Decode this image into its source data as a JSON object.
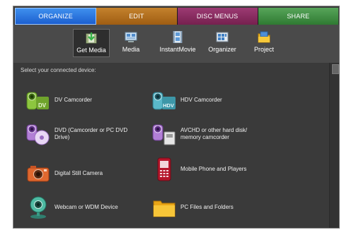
{
  "tabs": [
    {
      "label": "ORGANIZE",
      "active": true
    },
    {
      "label": "EDIT"
    },
    {
      "label": "DISC MENUS"
    },
    {
      "label": "SHARE"
    }
  ],
  "toolbar": {
    "items": [
      {
        "label": "Get Media",
        "icon": "get-media-icon",
        "selected": true
      },
      {
        "label": "Media",
        "icon": "media-icon"
      },
      {
        "label": "InstantMovie",
        "icon": "filmstrip-icon"
      },
      {
        "label": "Organizer",
        "icon": "organizer-icon"
      },
      {
        "label": "Project",
        "icon": "project-folder-icon"
      }
    ]
  },
  "prompt": "Select your connected device:",
  "devices": [
    {
      "label": "DV Camcorder",
      "icon": "dv-camcorder-icon"
    },
    {
      "label": "HDV Camcorder",
      "icon": "hdv-camcorder-icon"
    },
    {
      "label": "DVD (Camcorder or PC DVD Drive)",
      "icon": "dvd-camcorder-icon"
    },
    {
      "label": "AVCHD or other hard disk/ memory camcorder",
      "icon": "avchd-camcorder-icon"
    },
    {
      "label": "Digital Still Camera",
      "icon": "digital-camera-icon"
    },
    {
      "label": "Mobile Phone and Players",
      "icon": "mobile-phone-icon"
    },
    {
      "label": "Webcam or WDM Device",
      "icon": "webcam-icon"
    },
    {
      "label": "PC Files and Folders",
      "icon": "folder-icon"
    }
  ],
  "colors": {
    "organize": "#2a73df",
    "edit": "#b06f1e",
    "disc_menus": "#8a2c62",
    "share": "#439046",
    "panel": "#3a3a3a",
    "toolbar": "#4a4a4a"
  }
}
